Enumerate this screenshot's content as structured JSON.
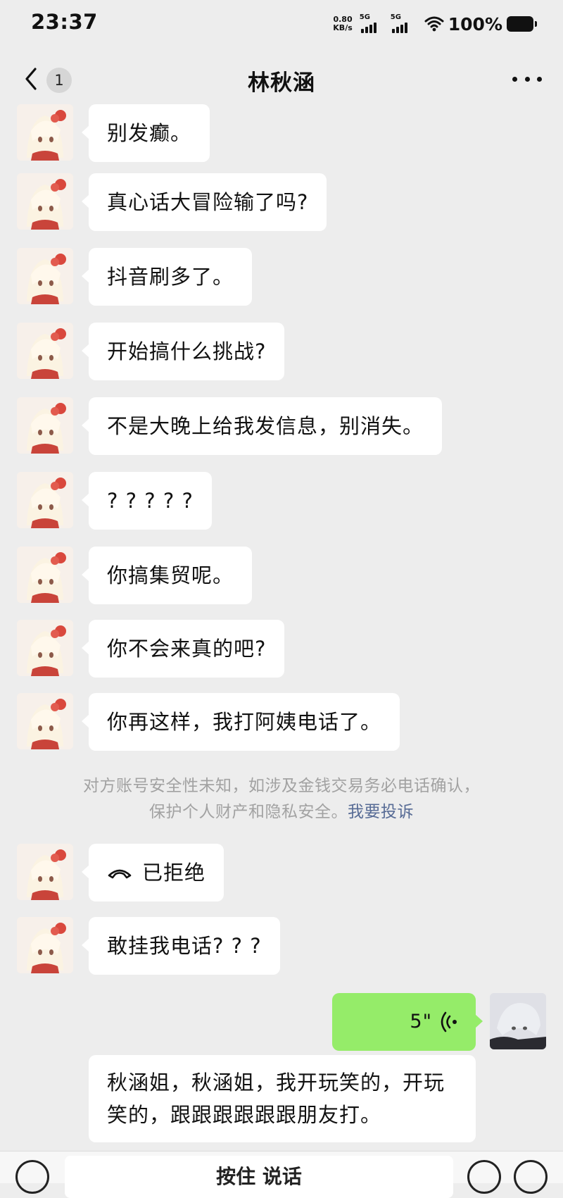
{
  "status_bar": {
    "time": "23:37",
    "net_speed_value": "0.80",
    "net_speed_unit": "KB/s",
    "signal_1_label": "5G",
    "signal_2_label": "5G",
    "battery_percent": "100%"
  },
  "nav": {
    "unread_count": "1",
    "title": "林秋涵"
  },
  "messages": [
    {
      "sender": "other",
      "text": "别发癫。"
    },
    {
      "sender": "other",
      "text": "真心话大冒险输了吗?"
    },
    {
      "sender": "other",
      "text": "抖音刷多了。"
    },
    {
      "sender": "other",
      "text": "开始搞什么挑战?"
    },
    {
      "sender": "other",
      "text": "不是大晚上给我发信息，别消失。"
    },
    {
      "sender": "other",
      "text": "? ? ? ? ?"
    },
    {
      "sender": "other",
      "text": "你搞集贸呢。"
    },
    {
      "sender": "other",
      "text": "你不会来真的吧?"
    },
    {
      "sender": "other",
      "text": "你再这样，我打阿姨电话了。"
    },
    {
      "sender": "other",
      "type": "call",
      "text": "已拒绝"
    },
    {
      "sender": "other",
      "text": "敢挂我电话? ? ?"
    },
    {
      "sender": "me",
      "type": "voice",
      "text": "5\""
    },
    {
      "sender": "other",
      "text": "秋涵姐，秋涵姐，我开玩笑的，开玩笑的，跟跟跟跟跟跟朋友打。"
    }
  ],
  "system_notice": {
    "line1": "对方账号安全性未知，如涉及金钱交易务必电话确认，",
    "line2": "保护个人财产和隐私安全。",
    "report_link": "我要投诉"
  },
  "input_bar": {
    "hold_to_talk": "按住 说话"
  },
  "colors": {
    "background": "#ededed",
    "voice_bubble": "#95ec69",
    "link": "#576b95"
  }
}
